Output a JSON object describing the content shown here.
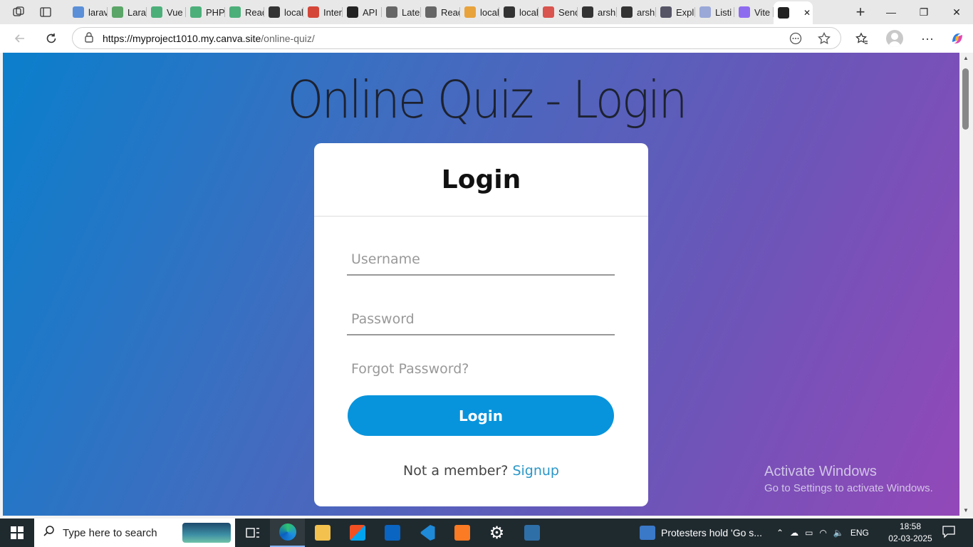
{
  "browser": {
    "tabs": [
      {
        "label": "larav",
        "icon": "search-icon",
        "color": "#5b8fd8"
      },
      {
        "label": "Larav",
        "icon": "green-circle-icon",
        "color": "#5aa567"
      },
      {
        "label": "Vue",
        "icon": "w-icon",
        "color": "#4caf7a"
      },
      {
        "label": "PHP",
        "icon": "w-icon",
        "color": "#4caf7a"
      },
      {
        "label": "Read",
        "icon": "w-icon",
        "color": "#4caf7a"
      },
      {
        "label": "local",
        "icon": "page-icon",
        "color": "#333333"
      },
      {
        "label": "Inter",
        "icon": "gmail-icon",
        "color": "#d44638"
      },
      {
        "label": "API",
        "icon": "openai-icon",
        "color": "#222222"
      },
      {
        "label": "Late",
        "icon": "openai-icon",
        "color": "#666666"
      },
      {
        "label": "Read",
        "icon": "openai-icon",
        "color": "#666666"
      },
      {
        "label": "local",
        "icon": "pma-icon",
        "color": "#e8a33c"
      },
      {
        "label": "local",
        "icon": "page-icon",
        "color": "#333333"
      },
      {
        "label": "Send",
        "icon": "pdf-icon",
        "color": "#d9534f"
      },
      {
        "label": "arsh",
        "icon": "github-icon",
        "color": "#333333"
      },
      {
        "label": "arsh",
        "icon": "github-icon",
        "color": "#333333"
      },
      {
        "label": "Expl",
        "icon": "mail-icon",
        "color": "#555566"
      },
      {
        "label": "Listi",
        "icon": "swirl-icon",
        "color": "#9aa8d8"
      },
      {
        "label": "Vite",
        "icon": "vite-icon",
        "color": "#8e6cf0"
      },
      {
        "label": "",
        "icon": "canva-icon",
        "color": "#222222"
      }
    ],
    "url_host": "https://myproject1010.my.canva.site",
    "url_path": "/online-quiz/"
  },
  "page": {
    "heading": "Online Quiz - Login",
    "card_title": "Login",
    "username_placeholder": "Username",
    "password_placeholder": "Password",
    "forgot": "Forgot Password?",
    "login_button": "Login",
    "signup_prefix": "Not a member?",
    "signup_link": "Signup"
  },
  "watermark": {
    "line1": "Activate Windows",
    "line2": "Go to Settings to activate Windows."
  },
  "taskbar": {
    "search_placeholder": "Type here to search",
    "news": "Protesters hold 'Go s...",
    "lang": "ENG",
    "time": "18:58",
    "date": "02-03-2025"
  },
  "colors": {
    "accent": "#0894dc",
    "link": "#2a97c8",
    "taskbar": "#1f2a2f"
  }
}
